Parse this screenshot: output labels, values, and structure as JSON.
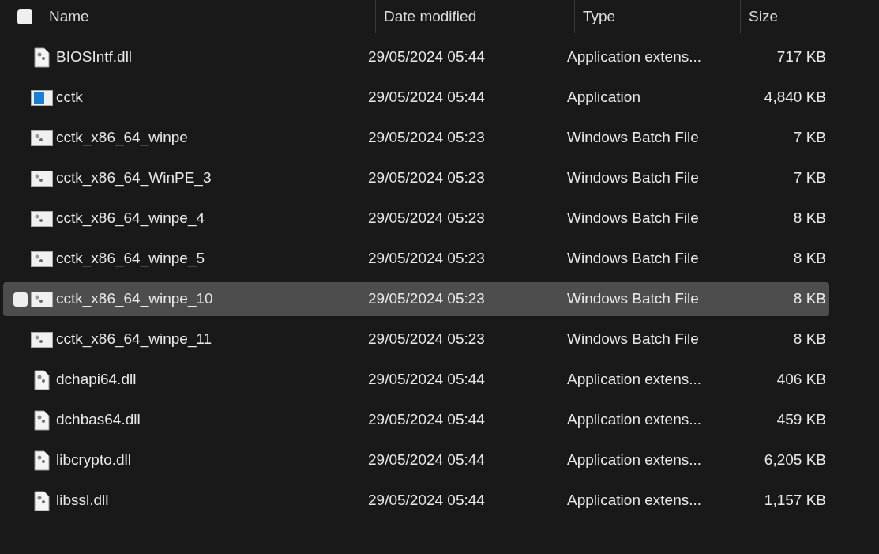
{
  "header": {
    "checked": false,
    "columns": [
      "Name",
      "Date modified",
      "Type",
      "Size"
    ]
  },
  "rows": [
    {
      "kind": "dll",
      "name": "BIOSIntf.dll",
      "date": "29/05/2024 05:44",
      "type": "Application extens...",
      "size": "717 KB",
      "hovered": false
    },
    {
      "kind": "exe",
      "name": "cctk",
      "date": "29/05/2024 05:44",
      "type": "Application",
      "size": "4,840 KB",
      "hovered": false
    },
    {
      "kind": "bat",
      "name": "cctk_x86_64_winpe",
      "date": "29/05/2024 05:23",
      "type": "Windows Batch File",
      "size": "7 KB",
      "hovered": false
    },
    {
      "kind": "bat",
      "name": "cctk_x86_64_WinPE_3",
      "date": "29/05/2024 05:23",
      "type": "Windows Batch File",
      "size": "7 KB",
      "hovered": false
    },
    {
      "kind": "bat",
      "name": "cctk_x86_64_winpe_4",
      "date": "29/05/2024 05:23",
      "type": "Windows Batch File",
      "size": "8 KB",
      "hovered": false
    },
    {
      "kind": "bat",
      "name": "cctk_x86_64_winpe_5",
      "date": "29/05/2024 05:23",
      "type": "Windows Batch File",
      "size": "8 KB",
      "hovered": false
    },
    {
      "kind": "bat",
      "name": "cctk_x86_64_winpe_10",
      "date": "29/05/2024 05:23",
      "type": "Windows Batch File",
      "size": "8 KB",
      "hovered": true
    },
    {
      "kind": "bat",
      "name": "cctk_x86_64_winpe_11",
      "date": "29/05/2024 05:23",
      "type": "Windows Batch File",
      "size": "8 KB",
      "hovered": false
    },
    {
      "kind": "dll",
      "name": "dchapi64.dll",
      "date": "29/05/2024 05:44",
      "type": "Application extens...",
      "size": "406 KB",
      "hovered": false
    },
    {
      "kind": "dll",
      "name": "dchbas64.dll",
      "date": "29/05/2024 05:44",
      "type": "Application extens...",
      "size": "459 KB",
      "hovered": false
    },
    {
      "kind": "dll",
      "name": "libcrypto.dll",
      "date": "29/05/2024 05:44",
      "type": "Application extens...",
      "size": "6,205 KB",
      "hovered": false
    },
    {
      "kind": "dll",
      "name": "libssl.dll",
      "date": "29/05/2024 05:44",
      "type": "Application extens...",
      "size": "1,157 KB",
      "hovered": false
    }
  ]
}
